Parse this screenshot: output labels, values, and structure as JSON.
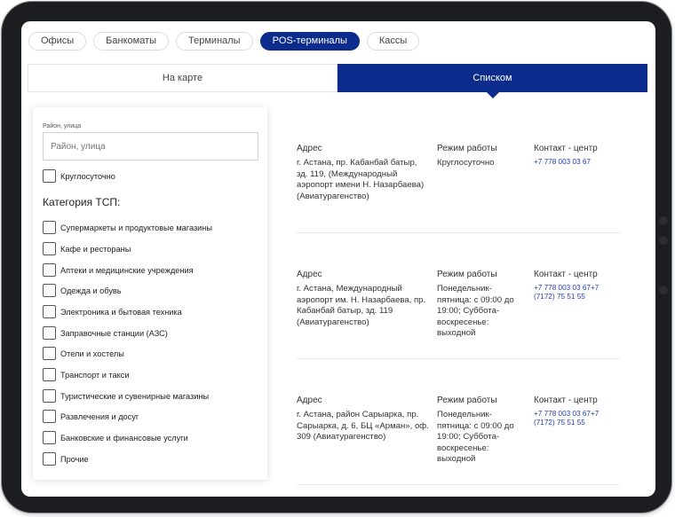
{
  "tabs": [
    {
      "label": "Офисы",
      "active": false
    },
    {
      "label": "Банкоматы",
      "active": false
    },
    {
      "label": "Терминалы",
      "active": false
    },
    {
      "label": "POS-терминалы",
      "active": true
    },
    {
      "label": "Кассы",
      "active": false
    }
  ],
  "view_switch": {
    "map_label": "На карте",
    "list_label": "Списком",
    "active": "list"
  },
  "filter": {
    "search_label": "Район, улица",
    "search_placeholder": "Район, улица",
    "search_value": "",
    "round_the_clock": "Круглосуточно",
    "category_title": "Категория ТСП:",
    "categories": [
      "Супермаркеты и продуктовые магазины",
      "Кафе и рестораны",
      "Аптеки и медицинские учреждения",
      "Одежда и обувь",
      "Электроника и бытовая техника",
      "Заправочные станции (АЗС)",
      "Отели и хостелы",
      "Транспорт и такси",
      "Туристические и сувенирные магазины",
      "Развлечения и досуг",
      "Банковские и финансовые услуги",
      "Прочие"
    ]
  },
  "list_headers": {
    "address": "Адрес",
    "hours": "Режим работы",
    "contact": "Контакт - центр"
  },
  "records": [
    {
      "address": "г. Астана, пр. Кабанбай батыр, зд. 119, (Международный аэропорт имени Н. Назарбаева) (Авиатурагенство)",
      "hours": "Круглосуточно",
      "contact": "+7 778 003 03 67"
    },
    {
      "address": "г. Астана, Международный аэропорт им. Н. Назарбаева, пр. Кабанбай батыр, зд. 119 (Авиатурагенство)",
      "hours": "Понедельник-пятница: с 09:00 до 19:00; Суббота-воскресенье: выходной",
      "contact": "+7 778 003 03 67+7 (7172) 75 51 55"
    },
    {
      "address": "г. Астана, район Сарыарка, пр. Сарыарка, д. 6, БЦ «Арман», оф. 309 (Авиатурагенство)",
      "hours": "Понедельник-пятница: с 09:00 до 19:00; Суббота-воскресенье: выходной",
      "contact": "+7 778 003 03 67+7 (7172) 75 51 55"
    }
  ],
  "colors": {
    "accent": "#0b2c8c",
    "link": "#1f3fb8",
    "device": "#1c1d20"
  }
}
